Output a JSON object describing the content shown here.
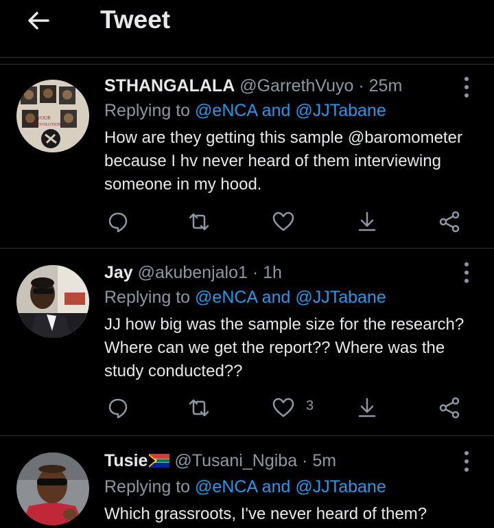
{
  "header": {
    "title": "Tweet",
    "back_icon": "arrow-left-icon"
  },
  "tweets": [
    {
      "name": "STHANGALALA",
      "handle": "@GarrethVuyo",
      "dot": "·",
      "time": "25m",
      "reply_prefix": "Replying to",
      "reply_to": "@eNCA and @JJTabane",
      "text": "How are they getting this sample @baromometer because I hv never heard of them interviewing someone in my hood.",
      "like_count": ""
    },
    {
      "name": "Jay",
      "handle": "@akubenjalo1",
      "dot": "·",
      "time": "1h",
      "reply_prefix": "Replying to",
      "reply_to": "@eNCA and @JJTabane",
      "text": "JJ how big was the sample size for the research? Where can we get the report?? Where was the study conducted??",
      "like_count": "3"
    },
    {
      "name": "Tusie",
      "handle": "@Tusani_Ngiba",
      "dot": "·",
      "time": "5m",
      "reply_prefix": "Replying to",
      "reply_to": "@eNCA and @JJTabane",
      "text": "Which grassroots, I've never heard of them?",
      "like_count": ""
    }
  ],
  "colors": {
    "background": "#000000",
    "text": "#e7e9ea",
    "muted": "#8b98a5",
    "link": "#1d9bf0",
    "divider": "#2f3336"
  }
}
